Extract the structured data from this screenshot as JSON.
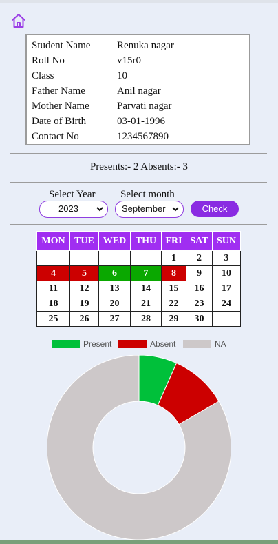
{
  "student": [
    {
      "label": "Student Name",
      "value": "Renuka nagar"
    },
    {
      "label": "Roll No",
      "value": "v15r0"
    },
    {
      "label": "Class",
      "value": "10"
    },
    {
      "label": "Father Name",
      "value": "Anil nagar"
    },
    {
      "label": "Mother Name",
      "value": "Parvati nagar"
    },
    {
      "label": "Date of Birth",
      "value": "03-01-1996"
    },
    {
      "label": "Contact No",
      "value": "1234567890"
    }
  ],
  "summary": "Presents:- 2 Absents:- 3",
  "filters": {
    "year_label": "Select Year",
    "year_value": "2023",
    "month_label": "Select month",
    "month_value": "September",
    "check_label": "Check"
  },
  "calendar": {
    "headers": [
      "MON",
      "TUE",
      "WED",
      "THU",
      "FRI",
      "SAT",
      "SUN"
    ],
    "weeks": [
      [
        "",
        "",
        "",
        "",
        "1",
        "2",
        "3"
      ],
      [
        "4",
        "5",
        "6",
        "7",
        "8",
        "9",
        "10"
      ],
      [
        "11",
        "12",
        "13",
        "14",
        "15",
        "16",
        "17"
      ],
      [
        "18",
        "19",
        "20",
        "21",
        "22",
        "23",
        "24"
      ],
      [
        "25",
        "26",
        "27",
        "28",
        "29",
        "30",
        ""
      ]
    ],
    "status": [
      [
        "",
        "",
        "",
        "",
        "",
        "",
        ""
      ],
      [
        "absent",
        "absent",
        "present",
        "present",
        "absent",
        "",
        ""
      ],
      [
        "",
        "",
        "",
        "",
        "",
        "",
        ""
      ],
      [
        "",
        "",
        "",
        "",
        "",
        "",
        ""
      ],
      [
        "",
        "",
        "",
        "",
        "",
        "",
        ""
      ]
    ]
  },
  "chart_data": {
    "type": "pie",
    "labels": [
      "Present",
      "Absent",
      "NA"
    ],
    "values": [
      2,
      3,
      25
    ],
    "colors": [
      "#00c03a",
      "#cc0000",
      "#cdc8c9"
    ],
    "legend": "top"
  }
}
